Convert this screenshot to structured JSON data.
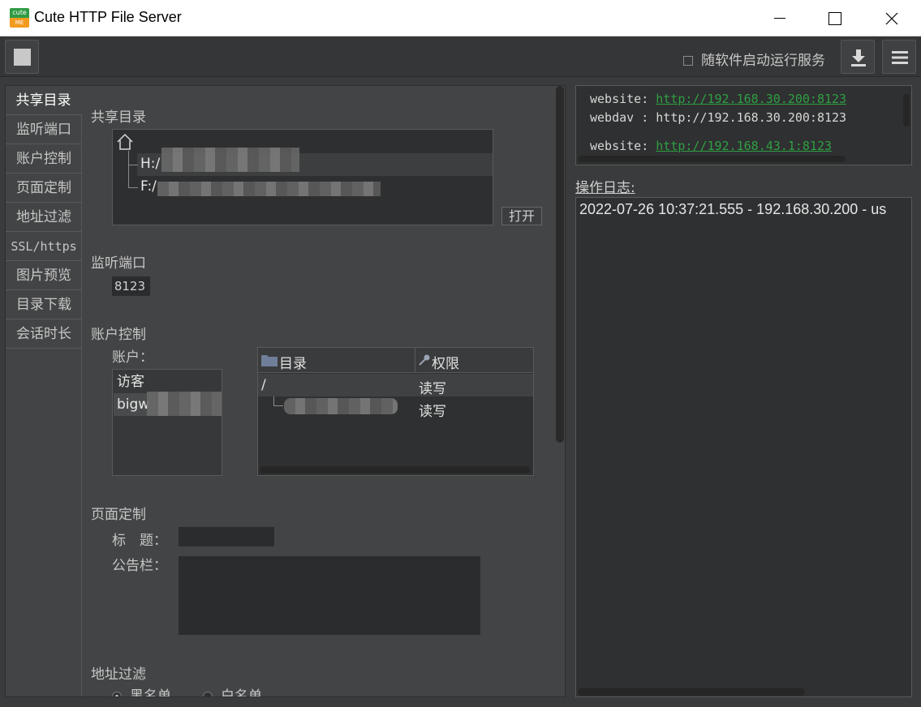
{
  "window": {
    "title": "Cute HTTP File Server",
    "logo_top": "cute",
    "logo_bottom": "ME"
  },
  "toolbar": {
    "autostart_label": "随软件启动运行服务",
    "icons": [
      "stop-icon",
      "download-icon",
      "menu-icon"
    ]
  },
  "tabs": [
    "共享目录",
    "监听端口",
    "账户控制",
    "页面定制",
    "地址过滤",
    "SSL/https",
    "图片预览",
    "目录下载",
    "会话时长"
  ],
  "shared_dir": {
    "label": "共享目录",
    "items": [
      "H:/",
      "F:/"
    ],
    "open_button": "打开"
  },
  "port": {
    "label": "监听端口",
    "value": "8123"
  },
  "accounts": {
    "label": "账户控制",
    "users_label": "账户：",
    "users": [
      "访客",
      "bigw"
    ],
    "table_headers": [
      "目录",
      "权限"
    ],
    "rows": [
      {
        "dir": "/",
        "perm": "读写"
      },
      {
        "dir": "",
        "perm": "读写"
      }
    ]
  },
  "page_custom": {
    "label": "页面定制",
    "title_label": "标　题：",
    "title_value": "",
    "board_label": "公告栏：",
    "board_value": ""
  },
  "ip_filter": {
    "label": "地址过滤",
    "options": [
      "黑名单",
      "白名单"
    ],
    "selected": "黑名单"
  },
  "addresses": [
    {
      "prefix": "website: ",
      "url": "http://192.168.30.200:8123",
      "link": true
    },
    {
      "prefix": "webdav : ",
      "url": "http://192.168.30.200:8123",
      "link": false
    },
    {
      "prefix": "website: ",
      "url": "http://192.168.43.1:8123",
      "link": true
    }
  ],
  "log": {
    "label": "操作日志:",
    "lines": [
      "2022-07-26 10:37:21.555 - 192.168.30.200 - us"
    ]
  }
}
